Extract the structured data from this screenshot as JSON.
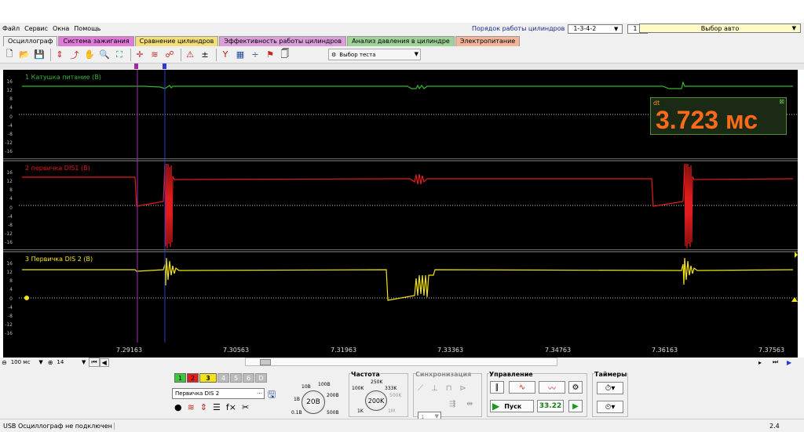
{
  "menu": {
    "items": [
      "Файл",
      "Сервис",
      "Окна",
      "Помощь"
    ]
  },
  "cylinder_order": {
    "label": "Порядок работы цилиндров",
    "value": "1-3-4-2",
    "spin_value": "1"
  },
  "car_select": {
    "label": "Выбор авто"
  },
  "tabs": [
    {
      "label": "Осциллограф",
      "color": "#f0f0f0"
    },
    {
      "label": "Система зажигания",
      "color": "#e07ad8"
    },
    {
      "label": "Сравнение цилиндров",
      "color": "#f2df7a"
    },
    {
      "label": "Эффективность работы цилиндров",
      "color": "#dba0d9"
    },
    {
      "label": "Анализ давления в цилиндре",
      "color": "#9fd39a"
    },
    {
      "label": "Электропитание",
      "color": "#f2b49b"
    }
  ],
  "toolbar": {
    "test_select_label": "Выбор теста"
  },
  "channels": [
    {
      "name": "1 Катушка питание (В)",
      "color": "#35b535"
    },
    {
      "name": "2 первичка DIS1 (В)",
      "color": "#e11c1c"
    },
    {
      "name": "3 Первичка DIS 2 (В)",
      "color": "#f2e413"
    }
  ],
  "y_ticks": [
    "16",
    "12",
    "8",
    "4",
    "0",
    "-4",
    "-8",
    "-12",
    "-16"
  ],
  "x_ticks": [
    "7.29163",
    "7.30563",
    "7.31963",
    "7.33363",
    "7.34763",
    "7.36163",
    "7.37563"
  ],
  "dt_readout": {
    "label": "dt",
    "value": "3.723 мс"
  },
  "timebase": {
    "value": "100 мс",
    "zoom": "14"
  },
  "channel_buttons": [
    "1",
    "2",
    "3",
    "4",
    "5",
    "6",
    "D"
  ],
  "channel_name_field": "Первичка DIS 2",
  "voltage_knob": {
    "center": "20В",
    "labels": [
      "10В",
      "100В",
      "1В",
      "200В",
      "0.1В",
      "500В"
    ]
  },
  "frequency": {
    "title": "Частота",
    "center": "200K",
    "labels": [
      "250K",
      "100K",
      "333K",
      "500K",
      "1K",
      "1M"
    ]
  },
  "sync": {
    "title": "Синхронизация",
    "value": "1"
  },
  "control": {
    "title": "Управление",
    "start_label": "Пуск",
    "rate": "33.22"
  },
  "timers": {
    "title": "Таймеры"
  },
  "status": {
    "connection": "USB Осциллограф не подключен",
    "version": "2.4"
  }
}
